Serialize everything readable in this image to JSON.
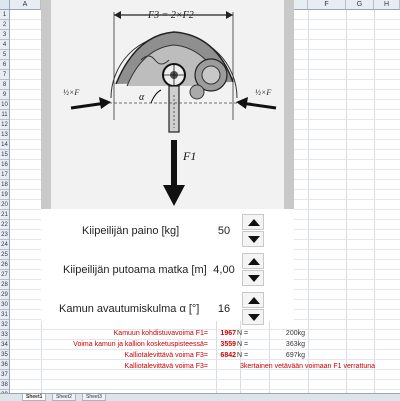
{
  "columns": [
    "A",
    "B",
    "C",
    "D",
    "E",
    "F",
    "G",
    "H"
  ],
  "rows": [
    "1",
    "2",
    "3",
    "4",
    "5",
    "6",
    "7",
    "8",
    "9",
    "10",
    "11",
    "12",
    "13",
    "14",
    "15",
    "16",
    "17",
    "18",
    "19",
    "20",
    "21",
    "22",
    "23",
    "24",
    "25",
    "26",
    "27",
    "28",
    "29",
    "30",
    "31",
    "32",
    "33",
    "34",
    "35",
    "36",
    "37",
    "38",
    "39"
  ],
  "figure": {
    "top_label": "F3 = 2×F2",
    "left_label": "½×F",
    "right_label": "½×F",
    "bottom_label": "F1",
    "alpha_symbol": "α"
  },
  "inputs": [
    {
      "label": "Kiipeilijän paino [kg]",
      "value": "50"
    },
    {
      "label": "Kiipeilijän putoama matka [m]",
      "value": "4,00"
    },
    {
      "label": "Kamun avautumiskulma α [°]",
      "value": "16"
    }
  ],
  "results": [
    {
      "label": "Kamuun kohdistuvavoima F1=",
      "value": "1967",
      "unit": "N =",
      "kg": "200kg"
    },
    {
      "label": "Voima kamun ja kallion kosketuspisteessä=",
      "value": "3559",
      "unit": "N =",
      "kg": "363kg"
    },
    {
      "label": "Kalliotalevittävä voima F3=",
      "value": "6842",
      "unit": "N =",
      "kg": "697kg"
    },
    {
      "label": "Kalliotalevittävä voima F3=",
      "wide": "3kertainen vetävään voimaan F1 verrattuna"
    }
  ],
  "sheet_tabs": [
    "Sheet1",
    "Sheet2",
    "Sheet3"
  ],
  "colors": {
    "result_red": "#d00000",
    "header_bg": "#e8edf4"
  }
}
